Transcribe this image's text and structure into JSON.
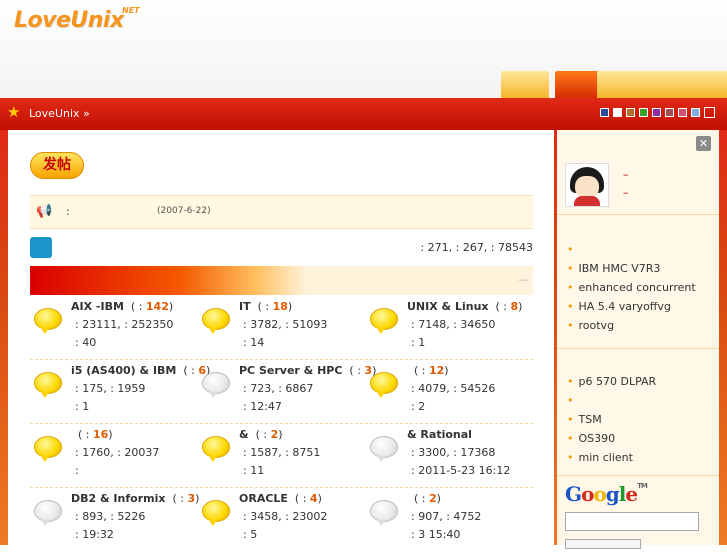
{
  "brand": {
    "logo": "LoveUnix",
    "logo_suffix": "NET"
  },
  "breadcrumb": {
    "text": "LoveUnix »"
  },
  "colors": {
    "accent_red": "#c10f00",
    "orange": "#f7941d",
    "count_orange": "#e05a00",
    "swatches": [
      "#2a4f9a",
      "#ffffff",
      "#b07030",
      "#3aa030",
      "#8a30a0",
      "#a05050",
      "#d05070",
      "#80b0e0",
      "#ffffff"
    ]
  },
  "toolbar": {
    "post_label": "发帖"
  },
  "announcement": {
    "icon": "speaker-icon",
    "colon": ":",
    "date": "(2007-6-22)"
  },
  "stats": {
    "text": ": 271,   : 267,   : 78543"
  },
  "category": {
    "collapse": "—"
  },
  "forums": [
    {
      "name": "AIX -IBM",
      "count": "142",
      "bubble": "yellow",
      "line1": ": 23111,   : 252350",
      "line2": ": 40"
    },
    {
      "name": "IT",
      "count": "18",
      "bubble": "yellow",
      "line1": ": 3782,   : 51093",
      "line2": ": 14"
    },
    {
      "name": "UNIX & Linux",
      "count": "8",
      "bubble": "yellow",
      "line1": ": 7148,   : 34650",
      "line2": ": 1"
    },
    {
      "name": "i5 (AS400) & IBM",
      "count": "6",
      "bubble": "yellow",
      "line1": ": 175,   : 1959",
      "line2": ": 1"
    },
    {
      "name": "PC Server & HPC",
      "count": "3",
      "bubble": "gray",
      "line1": ": 723,   : 6867",
      "line2": ":     12:47"
    },
    {
      "name": "",
      "count": "12",
      "bubble": "yellow",
      "line1": ": 4079,   : 54526",
      "line2": ": 2"
    },
    {
      "name": "",
      "count": "16",
      "bubble": "yellow",
      "line1": ": 1760,   : 20037",
      "line2": ":"
    },
    {
      "name": "&",
      "count": "2",
      "bubble": "yellow",
      "line1": ": 1587,   : 8751",
      "line2": ": 11"
    },
    {
      "name": "& Rational",
      "count": "",
      "bubble": "gray",
      "line1": ": 3300,   : 17368",
      "line2": ": 2011-5-23 16:12"
    },
    {
      "name": "DB2 & Informix",
      "count": "3",
      "bubble": "gray",
      "line1": ": 893,   : 5226",
      "line2": ":     19:32"
    },
    {
      "name": "ORACLE",
      "count": "4",
      "bubble": "yellow",
      "line1": ": 3458,   : 23002",
      "line2": ": 5"
    },
    {
      "name": "",
      "count": "2",
      "bubble": "gray",
      "line1": ": 907,   : 4752",
      "line2": ":  3   15:40"
    }
  ],
  "sidebar": {
    "dash1": "–",
    "dash2": "–",
    "list1": [
      "",
      "IBM HMC V7R3",
      "enhanced concurrent",
      "HA 5.4 varyoffvg",
      "rootvg"
    ],
    "list2": [
      "p6 570   DLPAR",
      "",
      "TSM",
      "OS390",
      "min   client"
    ],
    "google": {
      "G": "G",
      "o1": "o",
      "o2": "o",
      "g": "g",
      "l": "l",
      "e": "e",
      "tm": "TM"
    }
  }
}
